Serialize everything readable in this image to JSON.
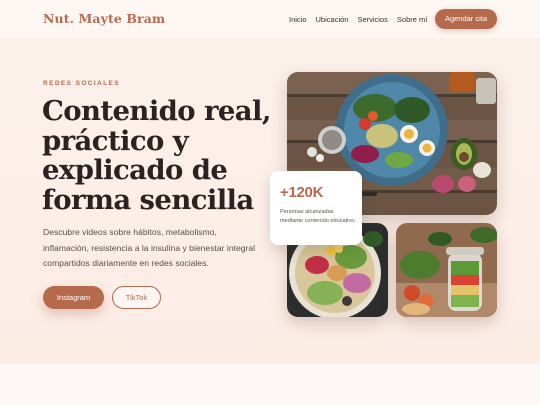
{
  "header": {
    "logo": "Nut. Mayte Bram",
    "nav": [
      "Inicio",
      "Ubicación",
      "Servicios",
      "Sobre mí"
    ],
    "cta": "Agendar cita"
  },
  "hero": {
    "eyebrow": "REDES SOCIALES",
    "title": "Contenido real, práctico y explicado de forma sencilla",
    "description": "Descubre videos sobre hábitos, metabolismo, inflamación, resistencia a la insulina y bienestar integral compartidos diariamente en redes sociales.",
    "buttons": {
      "instagram": "Instagram",
      "tiktok": "TikTok"
    },
    "stat": {
      "value": "+120K",
      "label": "Personas alcanzadas mediante contenido educativo."
    }
  },
  "colors": {
    "accent": "#b56a4e",
    "background": "#fbf3ee",
    "heading": "#2a2321"
  }
}
